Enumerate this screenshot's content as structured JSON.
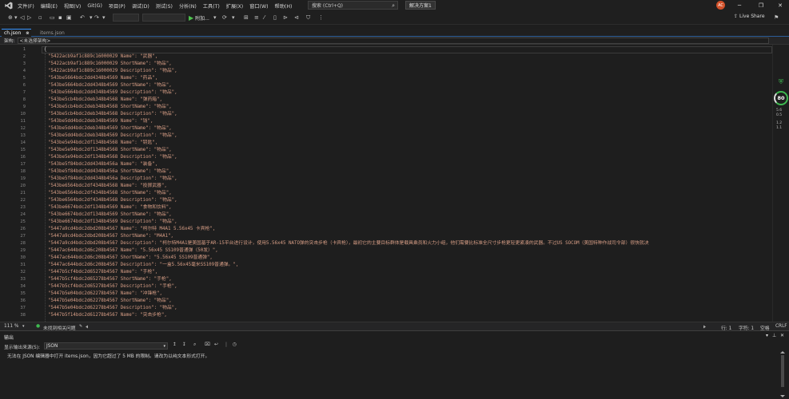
{
  "menubar": {
    "items": [
      "文件(F)",
      "编辑(E)",
      "视图(V)",
      "Git(G)",
      "项目(P)",
      "调试(D)",
      "测试(S)",
      "分析(N)",
      "工具(T)",
      "扩展(X)",
      "窗口(W)",
      "帮助(H)"
    ],
    "search_placeholder": "搜索 (Ctrl+Q)",
    "solution_name": "解决方案1",
    "avatar_initials": "AC"
  },
  "toolbar": {
    "run_label": "附加...",
    "live_share": "Live Share"
  },
  "tabs": [
    {
      "label": "ch.json",
      "close": "⊗",
      "active": true
    },
    {
      "label": "items.json",
      "active": false
    }
  ],
  "navbar": {
    "label": "架构:",
    "value": "<未选择架构>"
  },
  "editor": {
    "line_numbers": [
      "1",
      "2",
      "3",
      "4",
      "5",
      "6",
      "7",
      "8",
      "9",
      "10",
      "11",
      "12",
      "13",
      "14",
      "15",
      "16",
      "17",
      "18",
      "19",
      "20",
      "21",
      "22",
      "23",
      "24",
      "25",
      "26",
      "27",
      "28",
      "29",
      "30",
      "31",
      "32",
      "33",
      "34",
      "35",
      "36",
      "37",
      "38"
    ],
    "lines": [
      "{",
      "\"5422acb9af1c889c16000029 Name\": \"武器\",",
      "\"5422acb9af1c889c16000029 ShortName\": \"物品\",",
      "\"5422acb9af1c889c16000029 Description\": \"物品\",",
      "\"543be5664bdc2dd4348b4569 Name\": \"药品\",",
      "\"543be5664bdc2dd4348b4569 ShortName\": \"物品\",",
      "\"543be5664bdc2dd4348b4569 Description\": \"物品\",",
      "\"543be5cb4bdc2deb348b4568 Name\": \"弹药箱\",",
      "\"543be5cb4bdc2deb348b4568 ShortName\": \"物品\",",
      "\"543be5cb4bdc2deb348b4568 Description\": \"物品\",",
      "\"543be5dd4bdc2deb348b4569 Name\": \"钱\",",
      "\"543be5dd4bdc2deb348b4569 ShortName\": \"物品\",",
      "\"543be5dd4bdc2deb348b4569 Description\": \"物品\",",
      "\"543be5e94bdc2df1348b4568 Name\": \"钥匙\",",
      "\"543be5e94bdc2df1348b4568 ShortName\": \"物品\",",
      "\"543be5e94bdc2df1348b4568 Description\": \"物品\",",
      "\"543be5f84bdc2dd4348b456a Name\": \"装备\",",
      "\"543be5f84bdc2dd4348b456a ShortName\": \"物品\",",
      "\"543be5f84bdc2dd4348b456a Description\": \"物品\",",
      "\"543be6564bdc2df4348b4568 Name\": \"投掷武器\",",
      "\"543be6564bdc2df4348b4568 ShortName\": \"物品\",",
      "\"543be6564bdc2df4348b4568 Description\": \"物品\",",
      "\"543be6674bdc2df1348b4569 Name\": \"食物和饮料\",",
      "\"543be6674bdc2df1348b4569 ShortName\": \"物品\",",
      "\"543be6674bdc2df1348b4569 Description\": \"物品\",",
      "\"5447a9cd4bdc2dbd208b4567 Name\": \"柯尔特 M4A1 5.56x45 卡宾枪\",",
      "\"5447a9cd4bdc2dbd208b4567 ShortName\": \"M4A1\",",
      "\"5447a9cd4bdc2dbd208b4567 Description\": \"柯尔特M4A1是美国基于AR-15平台进行设计，使用5.56x45 NATO弹的突击步枪（卡宾枪），最初它的主要目标群体是载具乘员和火力小组，他们需要比标准全尺寸步枪更轻更紧凑的武器。不过US SOCOM（美国特种作战司令部）很快就决",
      "\"5447ac644bdc2d6c208b4567 Name\": \"5.56x45 SS109普通弹（50发）\",",
      "\"5447ac644bdc2d6c208b4567 ShortName\": \"5.56x45 SS109普通弹\",",
      "\"5447ac644bdc2d6c208b4567 Description\": \"一盒5.56x45毫米SS109普通弹。\",",
      "\"5447b5cf4bdc2d65278b4567 Name\": \"手枪\",",
      "\"5447b5cf4bdc2d65278b4567 ShortName\": \"手枪\",",
      "\"5447b5cf4bdc2d65278b4567 Description\": \"手枪\",",
      "\"5447b5e04bdc2d62278b4567 Name\": \"冲锋枪\",",
      "\"5447b5e04bdc2d62278b4567 ShortName\": \"物品\",",
      "\"5447b5e04bdc2d62278b4567 Description\": \"物品\",",
      "\"5447b5f14bdc2d61278b4567 Name\": \"突击步枪\","
    ]
  },
  "overview": {
    "score": "80",
    "stat1_top": "5.6",
    "stat1_bottom": "0.5",
    "stat2_top": "1.2",
    "stat2_bottom": "1.1"
  },
  "editor_status": {
    "zoom": "111 %",
    "issues": "未找到相关问题",
    "line": "行: 1",
    "char": "字符: 1",
    "spaces": "空格",
    "eol": "CRLF"
  },
  "output": {
    "title": "输出",
    "source_label": "显示输出来源(S):",
    "source_value": "JSON",
    "message": "无法在 JSON 编辑器中打开 items.json，因为它超过了 5 MB 的限制。请改为以纯文本形式打开。"
  },
  "colors": {
    "string": "#d69d85",
    "accent": "#3794ff",
    "ok": "#3fb950",
    "avatar": "#d2512a"
  }
}
